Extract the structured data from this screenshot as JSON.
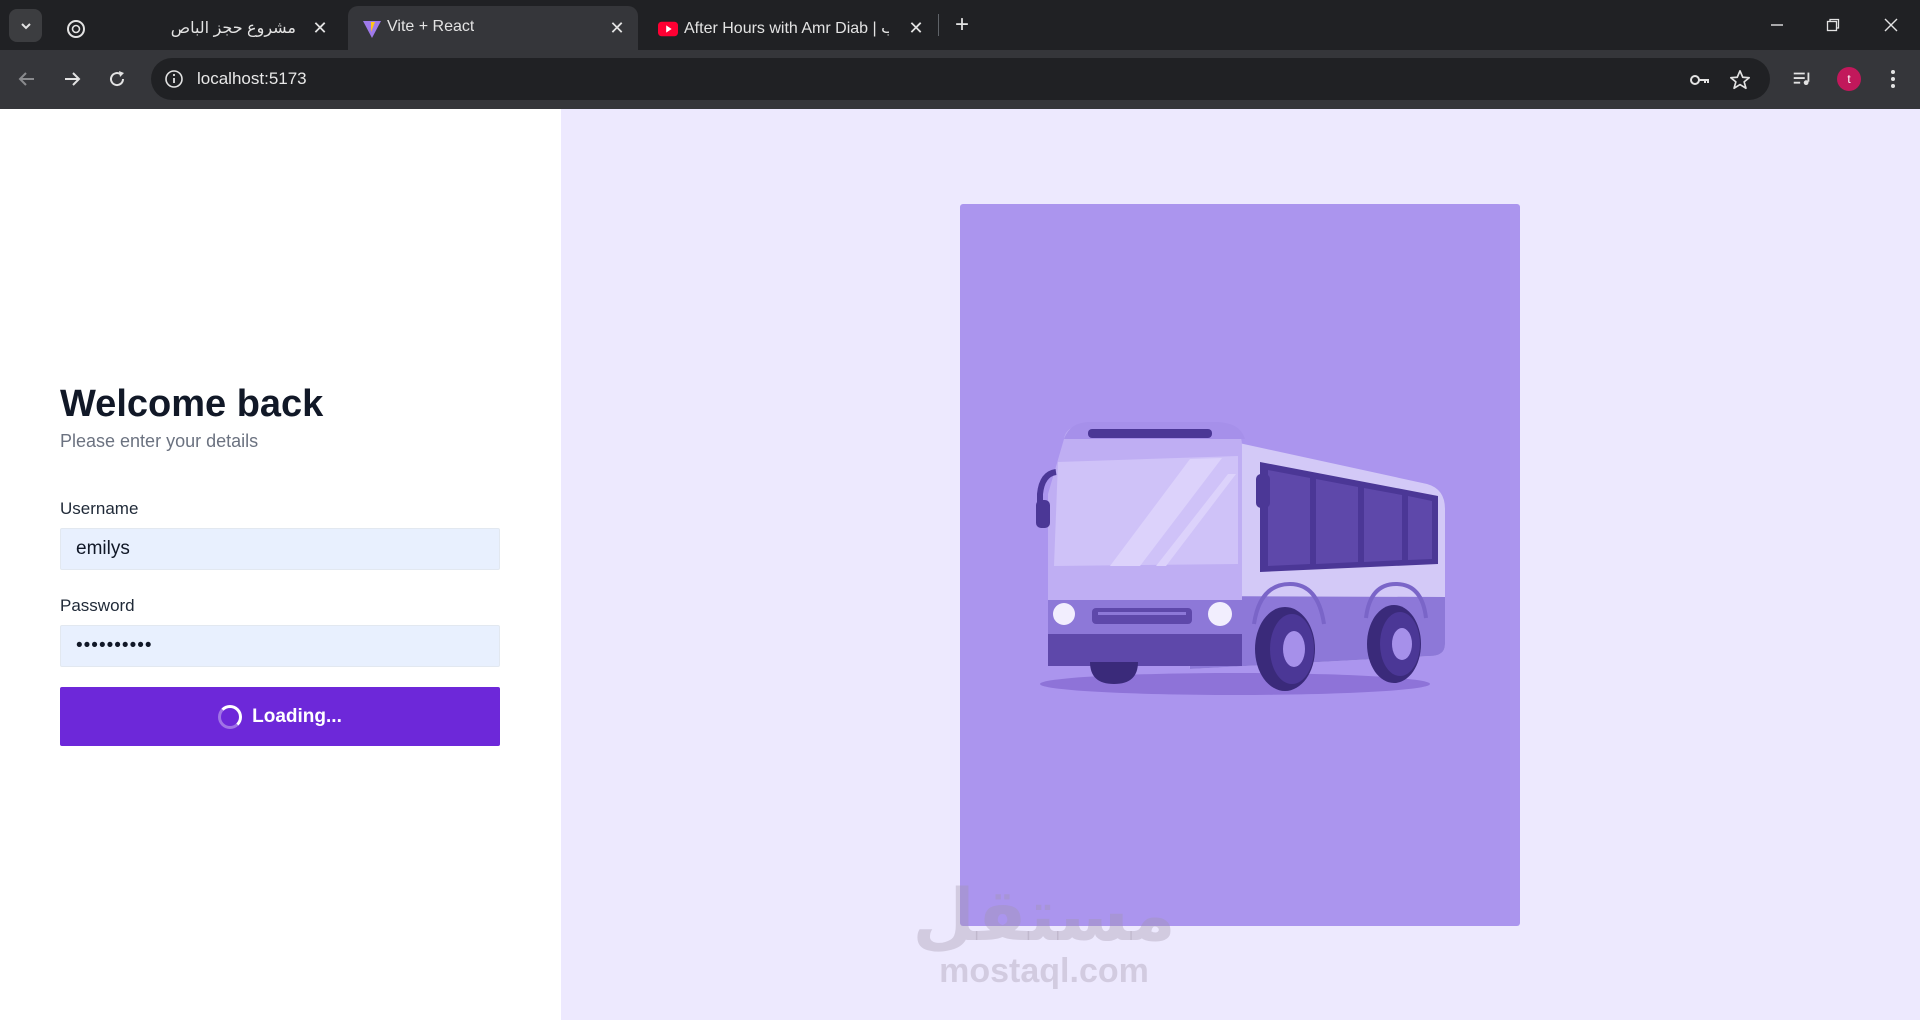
{
  "browser": {
    "tabs": [
      {
        "title": "مشروع حجز الباص",
        "favicon": "chatgpt-icon",
        "active": false
      },
      {
        "title": "Vite + React",
        "favicon": "vite-icon",
        "active": true
      },
      {
        "title": "After Hours with Amr Diab | باب",
        "favicon": "youtube-icon",
        "active": false
      }
    ],
    "url": "localhost:5173",
    "profile_initial": "t"
  },
  "login": {
    "title": "Welcome back",
    "subtitle": "Please enter your details",
    "username_label": "Username",
    "username_value": "emilys",
    "password_label": "Password",
    "password_value": "••••••••••",
    "button_label": "Loading..."
  },
  "illustration": {
    "subject": "bus-illustration",
    "background_color": "#ab95ee"
  },
  "watermark": {
    "arabic": "مستقل",
    "latin": "mostaql.com"
  },
  "colors": {
    "primary": "#6d28d9",
    "right_pane_bg": "#ede9fe",
    "input_bg": "#e8f0fe"
  }
}
